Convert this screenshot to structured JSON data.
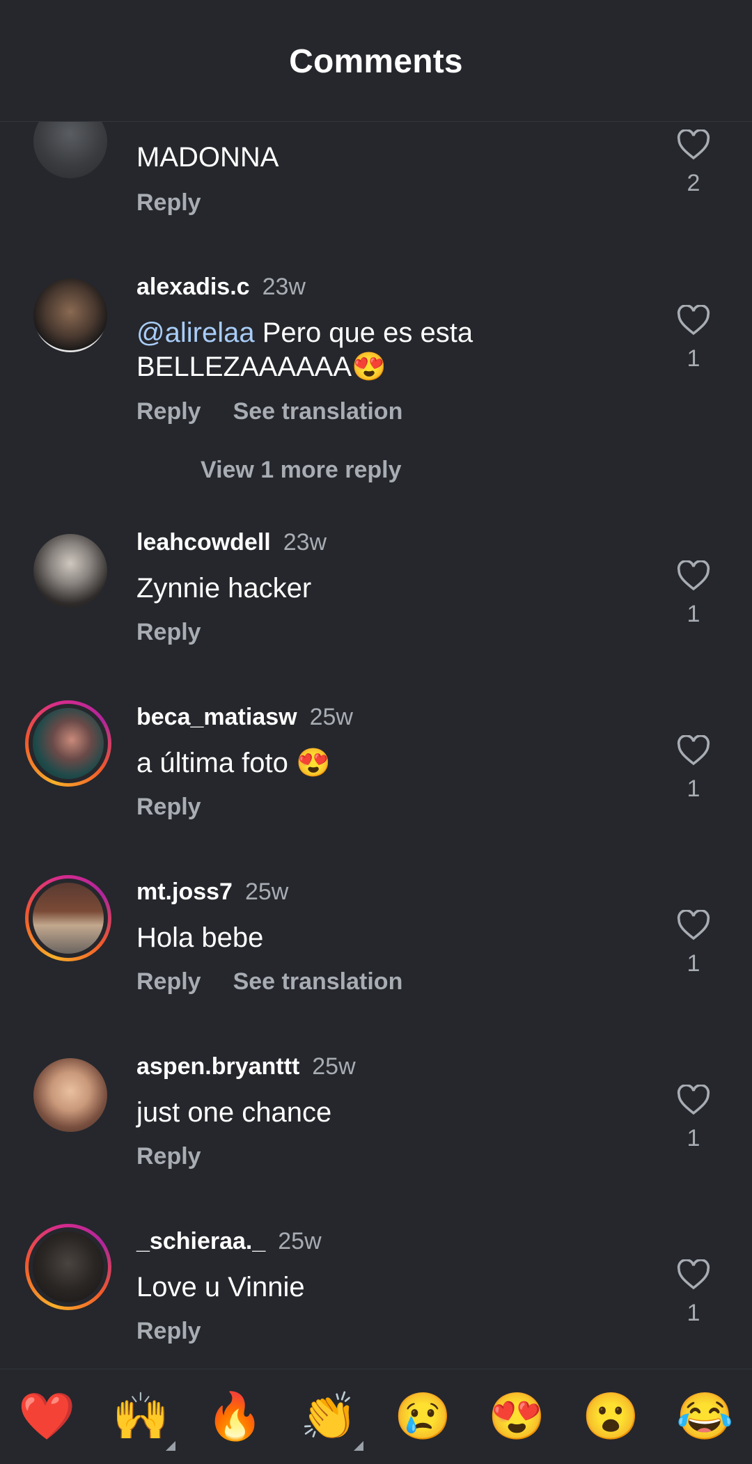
{
  "header": {
    "title": "Comments"
  },
  "comments": [
    {
      "username": "",
      "time": "",
      "text": "MADONNA",
      "mention": "",
      "reply": "Reply",
      "translate": "",
      "likes": "2"
    },
    {
      "username": "alexadis.c",
      "time": "23w",
      "mention": "@alirelaa",
      "text": " Pero que es esta BELLEZAAAAAA😍",
      "reply": "Reply",
      "translate": "See translation",
      "likes": "1",
      "view_more": "View 1 more reply"
    },
    {
      "username": "leahcowdell",
      "time": "23w",
      "mention": "",
      "text": "Zynnie hacker",
      "reply": "Reply",
      "translate": "",
      "likes": "1"
    },
    {
      "username": "beca_matiasw",
      "time": "25w",
      "mention": "",
      "text": "a última foto 😍",
      "reply": "Reply",
      "translate": "",
      "likes": "1"
    },
    {
      "username": "mt.joss7",
      "time": "25w",
      "mention": "",
      "text": "Hola bebe",
      "reply": "Reply",
      "translate": "See translation",
      "likes": "1"
    },
    {
      "username": "aspen.bryanttt",
      "time": "25w",
      "mention": "",
      "text": "just one chance",
      "reply": "Reply",
      "translate": "",
      "likes": "1"
    },
    {
      "username": "_schieraa._",
      "time": "25w",
      "mention": "",
      "text": "Love u Vinnie",
      "reply": "Reply",
      "translate": "",
      "likes": "1"
    }
  ],
  "emoji_bar": [
    "❤️",
    "🙌",
    "🔥",
    "👏",
    "😢",
    "😍",
    "😮",
    "😂"
  ],
  "colors": {
    "background": "#25272c",
    "secondary_text": "#a8acb3",
    "mention": "#a9cdf8"
  }
}
